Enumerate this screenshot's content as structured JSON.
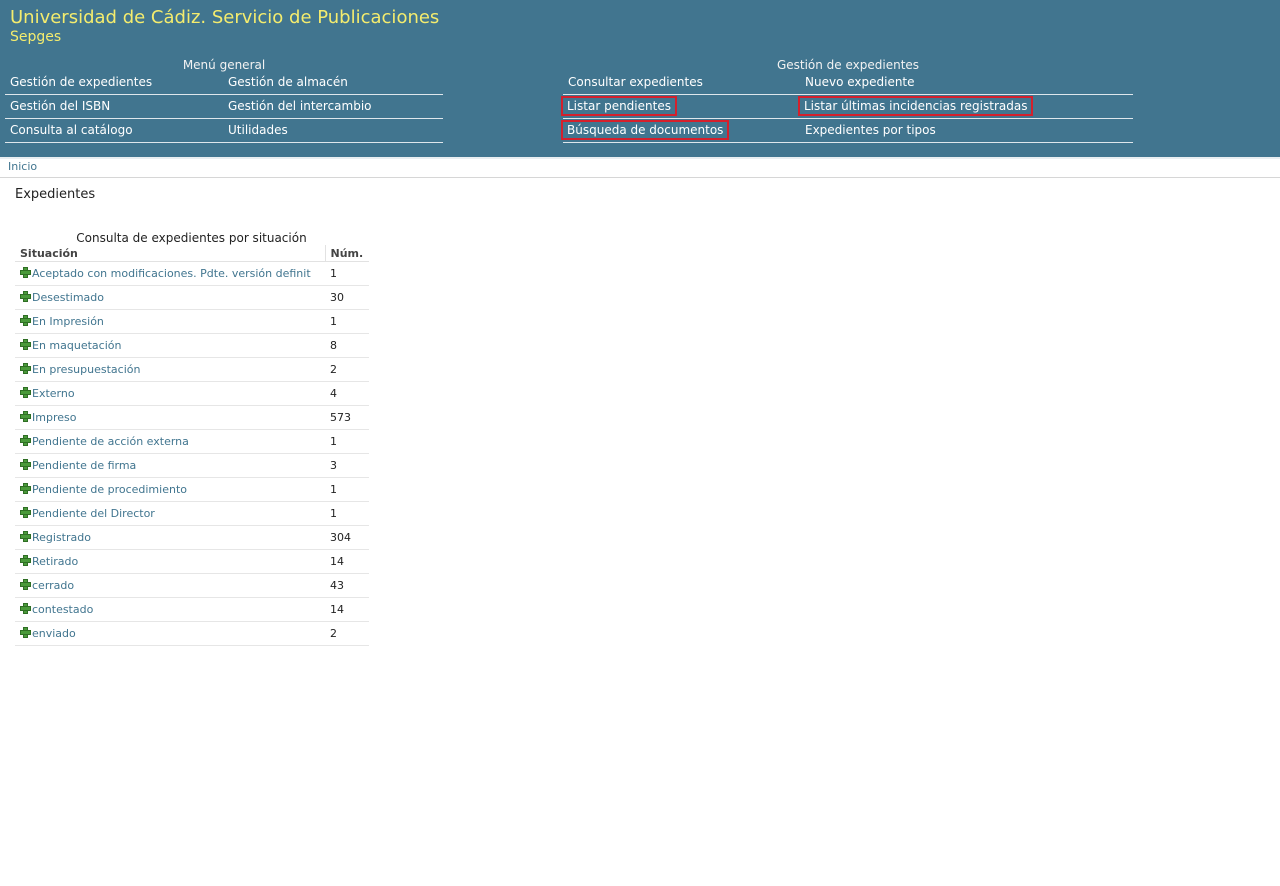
{
  "header": {
    "title": "Universidad de Cádiz. Servicio de Publicaciones",
    "subtitle": "Sepges"
  },
  "menu_general": {
    "title": "Menú general",
    "items": [
      "Gestión de expedientes",
      "Gestión de almacén",
      "Gestión del ISBN",
      "Gestión del intercambio",
      "Consulta al catálogo",
      "Utilidades"
    ]
  },
  "menu_expedientes": {
    "title": "Gestión de expedientes",
    "items": [
      "Consultar expedientes",
      "Nuevo expediente",
      "Listar pendientes",
      "Listar últimas incidencias registradas",
      "Búsqueda de documentos",
      "Expedientes por tipos"
    ]
  },
  "breadcrumb": "Inicio",
  "page_title": "Expedientes",
  "table": {
    "caption": "Consulta de expedientes por situación",
    "headers": [
      "Situación",
      "Núm."
    ],
    "rows": [
      {
        "name": "Aceptado con modificaciones. Pdte. versión definit",
        "count": "1"
      },
      {
        "name": "Desestimado",
        "count": "30"
      },
      {
        "name": "En Impresión",
        "count": "1"
      },
      {
        "name": "En maquetación",
        "count": "8"
      },
      {
        "name": "En presupuestación",
        "count": "2"
      },
      {
        "name": "Externo",
        "count": "4"
      },
      {
        "name": "Impreso",
        "count": "573"
      },
      {
        "name": "Pendiente de acción externa",
        "count": "1"
      },
      {
        "name": "Pendiente de firma",
        "count": "3"
      },
      {
        "name": "Pendiente de procedimiento",
        "count": "1"
      },
      {
        "name": "Pendiente del Director",
        "count": "1"
      },
      {
        "name": "Registrado",
        "count": "304"
      },
      {
        "name": "Retirado",
        "count": "14"
      },
      {
        "name": "cerrado",
        "count": "43"
      },
      {
        "name": "contestado",
        "count": "14"
      },
      {
        "name": "enviado",
        "count": "2"
      }
    ]
  },
  "colors": {
    "header_bg": "#41758f",
    "title_text": "#f4ec6e",
    "link": "#41758f",
    "highlight_box": "#d4202c",
    "plus_icon": "#4a9a3a"
  }
}
